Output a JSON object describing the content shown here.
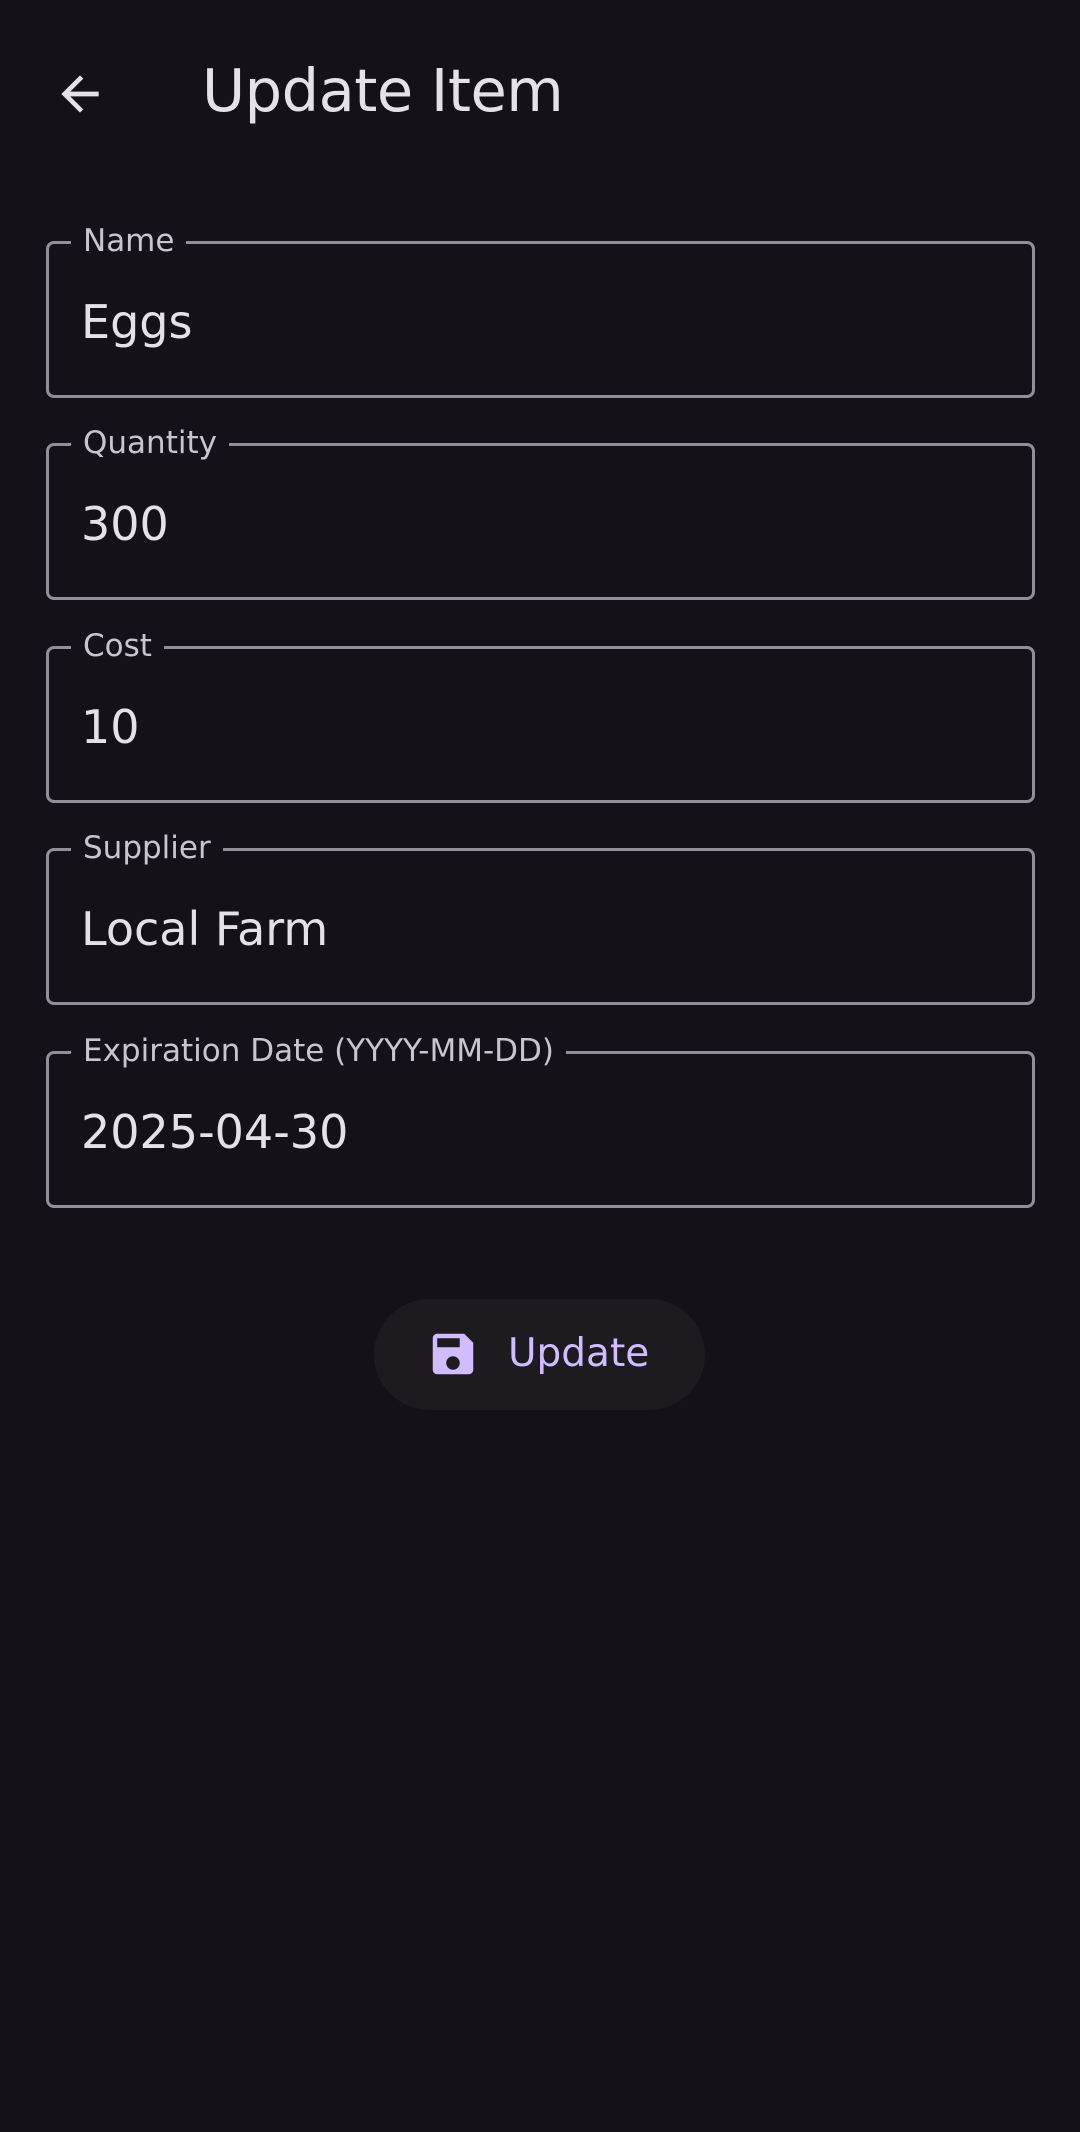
{
  "header": {
    "title": "Update Item",
    "back_icon": "arrow-back-icon"
  },
  "form": {
    "fields": [
      {
        "label": "Name",
        "value": "Eggs"
      },
      {
        "label": "Quantity",
        "value": "300"
      },
      {
        "label": "Cost",
        "value": "10"
      },
      {
        "label": "Supplier",
        "value": "Local Farm"
      },
      {
        "label": "Expiration Date (YYYY-MM-DD)",
        "value": "2025-04-30"
      }
    ]
  },
  "actions": {
    "update_label": "Update",
    "update_icon": "save-icon"
  },
  "colors": {
    "background": "#141218",
    "on_surface": "#E6E0E9",
    "outline": "#938F99",
    "label": "#CAC4D0",
    "primary": "#D0BCFF",
    "button_surface": "#1D1B20"
  }
}
